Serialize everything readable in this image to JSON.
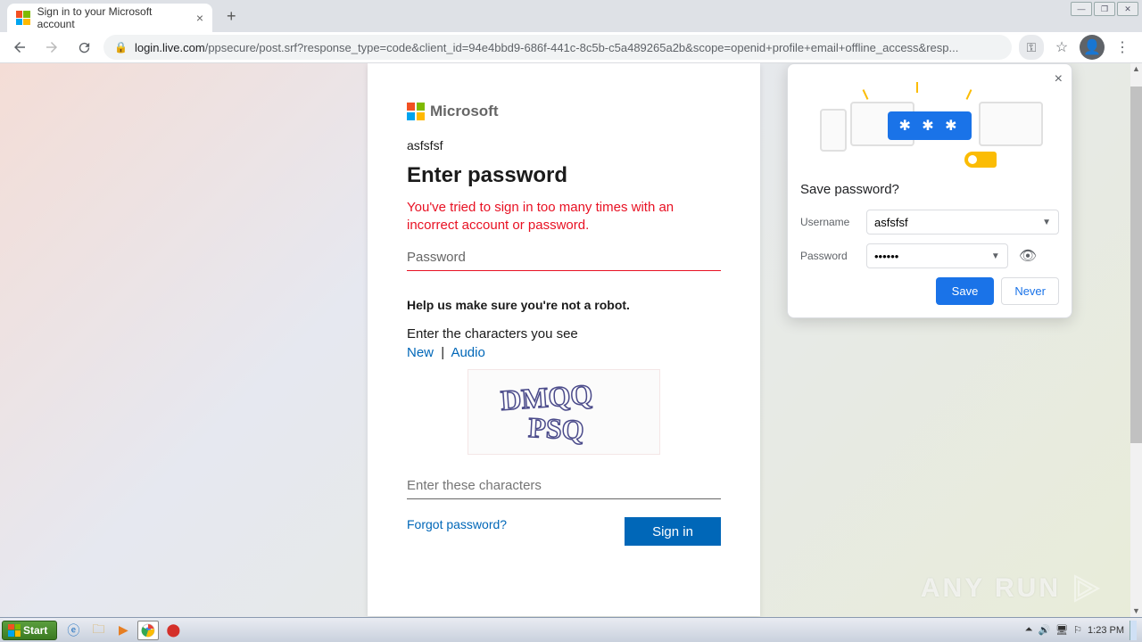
{
  "browser": {
    "tab_title": "Sign in to your Microsoft account",
    "url_domain": "login.live.com",
    "url_path": "/ppsecure/post.srf?response_type=code&client_id=94e4bbd9-686f-441c-8c5b-c5a489265a2b&scope=openid+profile+email+offline_access&resp..."
  },
  "login": {
    "logo_text": "Microsoft",
    "identity": "asfsfsf",
    "heading": "Enter password",
    "error": "You've tried to sign in too many times with an incorrect account or password.",
    "password_placeholder": "Password",
    "robot_heading": "Help us make sure you're not a robot.",
    "captcha_instruction": "Enter the characters you see",
    "captcha_new": "New",
    "captcha_sep": "|",
    "captcha_audio": "Audio",
    "captcha_text_top": "DMQQ",
    "captcha_text_bot": "PSQ",
    "captcha_input_placeholder": "Enter these characters",
    "forgot": "Forgot password?",
    "signin": "Sign in"
  },
  "save_pwd": {
    "title": "Save password?",
    "username_label": "Username",
    "username_value": "asfsfsf",
    "password_label": "Password",
    "password_value": "••••••",
    "save": "Save",
    "never": "Never",
    "illus_stars": "✱ ✱ ✱"
  },
  "watermark": "ANY     RUN",
  "taskbar": {
    "start": "Start",
    "clock": "1:23 PM"
  }
}
